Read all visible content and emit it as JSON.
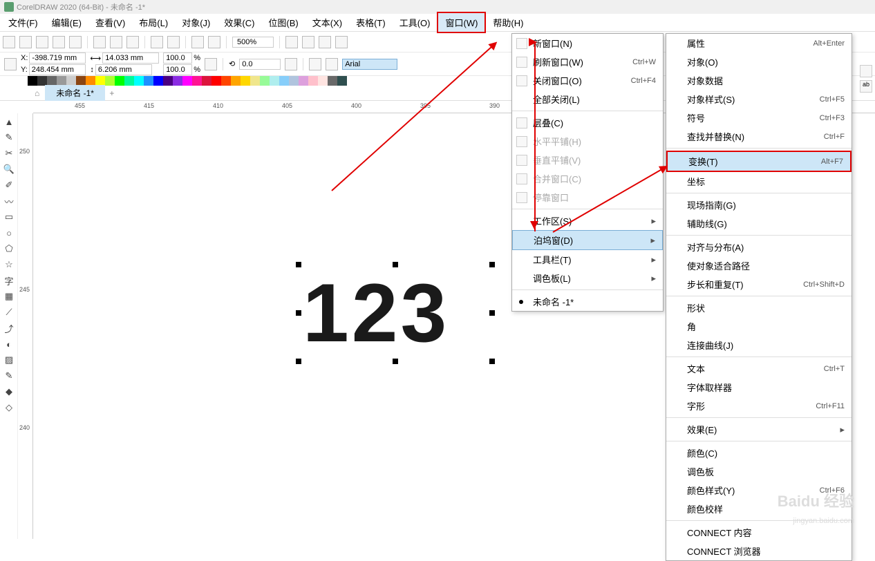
{
  "title": "CorelDRAW 2020 (64-Bit) - 未命名 -1*",
  "menu": [
    "文件(F)",
    "编辑(E)",
    "查看(V)",
    "布局(L)",
    "对象(J)",
    "效果(C)",
    "位图(B)",
    "文本(X)",
    "表格(T)",
    "工具(O)",
    "窗口(W)",
    "帮助(H)"
  ],
  "menu_hl_index": 10,
  "zoom": "500%",
  "coords": {
    "x_label": "X:",
    "y_label": "Y:",
    "x": "-398.719 mm",
    "y": "248.454 mm",
    "w": "14.033 mm",
    "h": "6.206 mm",
    "sx": "100.0",
    "sy": "100.0",
    "pct": "%"
  },
  "rotation": "0.0",
  "font": "Arial",
  "tab": "未命名 -1*",
  "ruler_h": [
    "455",
    "415",
    "410",
    "405",
    "400",
    "395",
    "390"
  ],
  "ruler_v": [
    "250",
    "245",
    "240"
  ],
  "canvas_text": "123",
  "window_menu": [
    {
      "label": "新窗口(N)",
      "ic": true
    },
    {
      "label": "刷新窗口(W)",
      "sc": "Ctrl+W",
      "ic": true
    },
    {
      "label": "关闭窗口(O)",
      "sc": "Ctrl+F4",
      "ic": true
    },
    {
      "label": "全部关闭(L)"
    },
    {
      "sep": true
    },
    {
      "label": "层叠(C)",
      "ic": true
    },
    {
      "label": "水平平铺(H)",
      "dis": true,
      "ic": true
    },
    {
      "label": "垂直平铺(V)",
      "dis": true,
      "ic": true
    },
    {
      "label": "合并窗口(C)",
      "dis": true,
      "ic": true
    },
    {
      "label": "停靠窗口",
      "dis": true,
      "ic": true
    },
    {
      "sep": true
    },
    {
      "label": "工作区(S)",
      "arr": true
    },
    {
      "label": "泊坞窗(D)",
      "arr": true,
      "hl": true
    },
    {
      "label": "工具栏(T)",
      "arr": true
    },
    {
      "label": "调色板(L)",
      "arr": true
    },
    {
      "sep": true
    },
    {
      "label": "未命名 -1*",
      "dot": true
    }
  ],
  "docker_menu": [
    {
      "label": "属性",
      "sc": "Alt+Enter"
    },
    {
      "label": "对象(O)"
    },
    {
      "label": "对象数据"
    },
    {
      "label": "对象样式(S)",
      "sc": "Ctrl+F5"
    },
    {
      "label": "符号",
      "sc": "Ctrl+F3"
    },
    {
      "label": "查找并替换(N)",
      "sc": "Ctrl+F"
    },
    {
      "sep": true
    },
    {
      "label": "变换(T)",
      "sc": "Alt+F7",
      "highlighted": true
    },
    {
      "label": "坐标"
    },
    {
      "sep": true
    },
    {
      "label": "现场指南(G)"
    },
    {
      "label": "辅助线(G)"
    },
    {
      "sep": true
    },
    {
      "label": "对齐与分布(A)"
    },
    {
      "label": "使对象适合路径"
    },
    {
      "label": "步长和重复(T)",
      "sc": "Ctrl+Shift+D"
    },
    {
      "sep": true
    },
    {
      "label": "形状"
    },
    {
      "label": "角"
    },
    {
      "label": "连接曲线(J)"
    },
    {
      "sep": true
    },
    {
      "label": "文本",
      "sc": "Ctrl+T"
    },
    {
      "label": "字体取样器"
    },
    {
      "label": "字形",
      "sc": "Ctrl+F11"
    },
    {
      "sep": true
    },
    {
      "label": "效果(E)",
      "arr": true
    },
    {
      "sep": true
    },
    {
      "label": "颜色(C)"
    },
    {
      "label": "调色板"
    },
    {
      "label": "颜色样式(Y)",
      "sc": "Ctrl+F6"
    },
    {
      "label": "颜色校样"
    },
    {
      "sep": true
    },
    {
      "label": "CONNECT 内容"
    },
    {
      "label": "CONNECT 浏览器"
    }
  ],
  "palette": [
    "#fff",
    "#000",
    "#333",
    "#666",
    "#999",
    "#ccc",
    "#8b4513",
    "#ff8c00",
    "#ffff00",
    "#adff2f",
    "#00ff00",
    "#00fa9a",
    "#00ffff",
    "#1e90ff",
    "#0000ff",
    "#4b0082",
    "#8a2be2",
    "#ff00ff",
    "#ff1493",
    "#dc143c",
    "#ff0000",
    "#ff4500",
    "#ffa500",
    "#ffd700",
    "#f0e68c",
    "#98fb98",
    "#afeeee",
    "#87cefa",
    "#b0c4de",
    "#dda0dd",
    "#ffc0cb",
    "#ffe4e1",
    "#696969",
    "#2f4f4f"
  ],
  "watermark": "Baidu 经验",
  "watermark_sub": "jingyan.baidu.com"
}
